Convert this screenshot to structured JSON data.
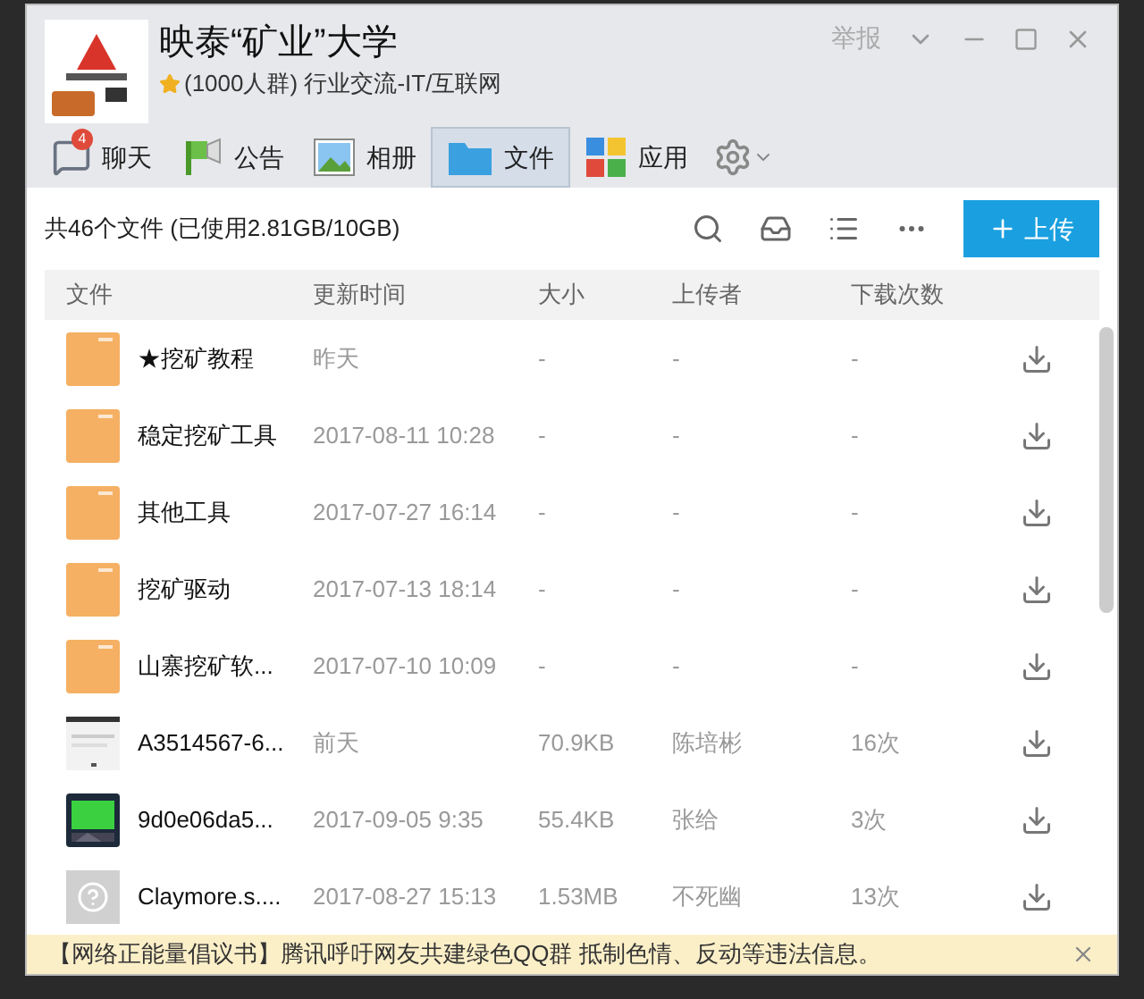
{
  "window": {
    "title": "映泰“矿业”大学",
    "subtitle": "(1000人群) 行业交流-IT/互联网",
    "report": "举报"
  },
  "tabs": [
    {
      "label": "聊天",
      "kind": "chat",
      "badge": "4",
      "selected": false
    },
    {
      "label": "公告",
      "kind": "notice",
      "selected": false
    },
    {
      "label": "相册",
      "kind": "album",
      "selected": false
    },
    {
      "label": "文件",
      "kind": "files",
      "selected": true
    },
    {
      "label": "应用",
      "kind": "apps",
      "selected": false
    }
  ],
  "summary": "共46个文件 (已使用2.81GB/10GB)",
  "upload_button": "上传",
  "table": {
    "columns": [
      "文件",
      "更新时间",
      "大小",
      "上传者",
      "下载次数"
    ],
    "rows": [
      {
        "kind": "folder",
        "name": "★挖矿教程",
        "time": "昨天",
        "size": "-",
        "uploader": "-",
        "downloads": "-"
      },
      {
        "kind": "folder",
        "name": "稳定挖矿工具",
        "time": "2017-08-11 10:28",
        "size": "-",
        "uploader": "-",
        "downloads": "-"
      },
      {
        "kind": "folder",
        "name": "其他工具",
        "time": "2017-07-27 16:14",
        "size": "-",
        "uploader": "-",
        "downloads": "-"
      },
      {
        "kind": "folder",
        "name": "挖矿驱动",
        "time": "2017-07-13 18:14",
        "size": "-",
        "uploader": "-",
        "downloads": "-"
      },
      {
        "kind": "folder",
        "name": "山寨挖矿软...",
        "time": "2017-07-10 10:09",
        "size": "-",
        "uploader": "-",
        "downloads": "-"
      },
      {
        "kind": "document",
        "name": "A3514567-6...",
        "time": "前天",
        "size": "70.9KB",
        "uploader": "陈培彬",
        "downloads": "16次"
      },
      {
        "kind": "picture",
        "name": "9d0e06da5...",
        "time": "2017-09-05 9:35",
        "size": "55.4KB",
        "uploader": "张给",
        "downloads": "3次"
      },
      {
        "kind": "unknown",
        "name": "Claymore.s....",
        "time": "2017-08-27 15:13",
        "size": "1.53MB",
        "uploader": "不死幽",
        "downloads": "13次"
      }
    ]
  },
  "notice": "【网络正能量倡议书】腾讯呼吁网友共建绿色QQ群 抵制色情、反动等违法信息。"
}
